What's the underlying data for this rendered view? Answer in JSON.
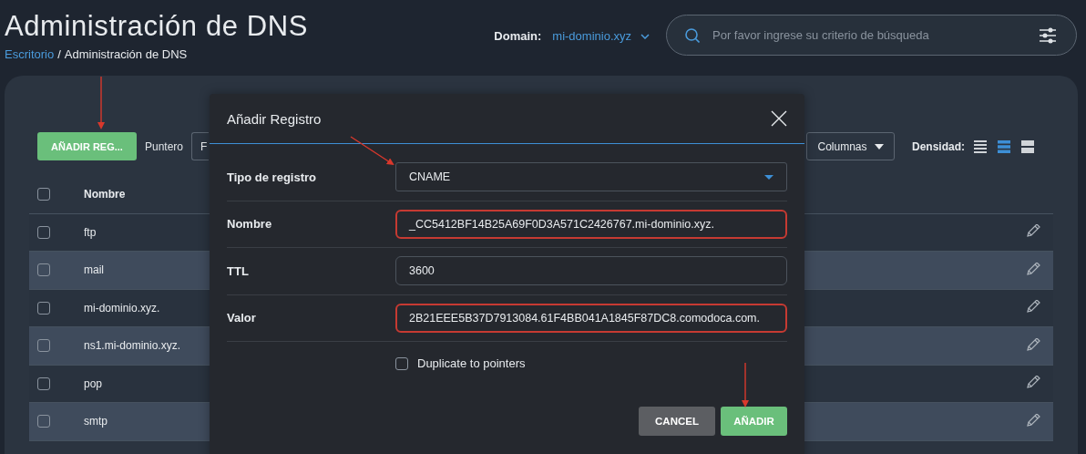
{
  "header": {
    "title": "Administración de DNS",
    "breadcrumb": {
      "link": "Escritorio",
      "separator": "/",
      "current": "Administración de DNS"
    },
    "domain": {
      "label": "Domain:",
      "value": "mi-dominio.xyz"
    },
    "search": {
      "placeholder": "Por favor ingrese su criterio de búsqueda"
    }
  },
  "toolbar": {
    "add_button": "AÑADIR REG...",
    "pointer_label": "Puntero",
    "pointer_field": {
      "value": "F"
    },
    "columns_button": "Columnas",
    "density_label": "Densidad:",
    "density_options": [
      {
        "kind": "compact",
        "selected": false
      },
      {
        "kind": "standard",
        "selected": true
      },
      {
        "kind": "comfortable",
        "selected": false
      }
    ]
  },
  "table": {
    "columns": [
      "Nombre"
    ],
    "select_all_checked": false,
    "rows": [
      {
        "name": "ftp",
        "checked": false
      },
      {
        "name": "mail",
        "checked": false
      },
      {
        "name": "mi-dominio.xyz.",
        "checked": false
      },
      {
        "name": "ns1.mi-dominio.xyz.",
        "checked": false
      },
      {
        "name": "pop",
        "checked": false
      },
      {
        "name": "smtp",
        "checked": false
      }
    ]
  },
  "dialog": {
    "title": "Añadir Registro",
    "fields": [
      {
        "label": "Tipo de registro",
        "kind": "select",
        "value": "CNAME",
        "highlighted": false
      },
      {
        "label": "Nombre",
        "kind": "text",
        "value": "_CC5412BF14B25A69F0D3A571C2426767.mi-dominio.xyz.",
        "highlighted": true
      },
      {
        "label": "TTL",
        "kind": "text",
        "value": "3600",
        "highlighted": false
      },
      {
        "label": "Valor",
        "kind": "text",
        "value": "2B21EEE5B37D7913084.61F4BB041A1845F87DC8.comodoca.com.",
        "highlighted": true
      }
    ],
    "duplicate": {
      "label": "Duplicate to pointers",
      "checked": false
    },
    "buttons": [
      {
        "label": "CANCEL",
        "kind": "secondary"
      },
      {
        "label": "AÑADIR",
        "kind": "primary"
      }
    ]
  }
}
